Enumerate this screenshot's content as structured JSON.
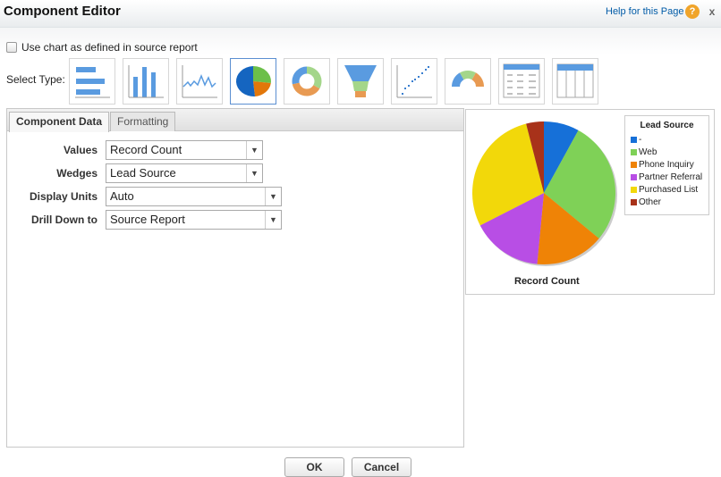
{
  "header": {
    "title": "Component Editor",
    "help_link": "Help for this Page",
    "help_icon": "?",
    "close_label": "x"
  },
  "options": {
    "use_source_chart_label": "Use chart as defined in source report",
    "use_source_chart_checked": false
  },
  "chart_types": {
    "label": "Select Type:",
    "items": [
      "horizontal-bar",
      "vertical-bar",
      "line",
      "pie",
      "donut",
      "funnel",
      "scatter",
      "gauge",
      "table",
      "metric-table"
    ],
    "selected": "pie"
  },
  "tabs": [
    {
      "label": "Component Data",
      "active": true
    },
    {
      "label": "Formatting",
      "active": false
    }
  ],
  "form": [
    {
      "label": "Values",
      "value": "Record Count"
    },
    {
      "label": "Wedges",
      "value": "Lead Source"
    },
    {
      "label": "Display Units",
      "value": "Auto"
    },
    {
      "label": "Drill Down to",
      "value": "Source Report"
    }
  ],
  "chart_data": {
    "type": "pie",
    "title": "Record Count",
    "legend_title": "Lead Source",
    "legend_placement": "right",
    "categories": [
      "-",
      "Web",
      "Phone Inquiry",
      "Partner Referral",
      "Purchased List",
      "Other"
    ],
    "values": [
      8,
      28,
      15.5,
      16,
      28.5,
      4
    ],
    "colors": [
      "#1670d8",
      "#7fd157",
      "#ef8306",
      "#b84ee5",
      "#f2d80a",
      "#a8321a"
    ]
  },
  "buttons": {
    "ok": "OK",
    "cancel": "Cancel"
  }
}
